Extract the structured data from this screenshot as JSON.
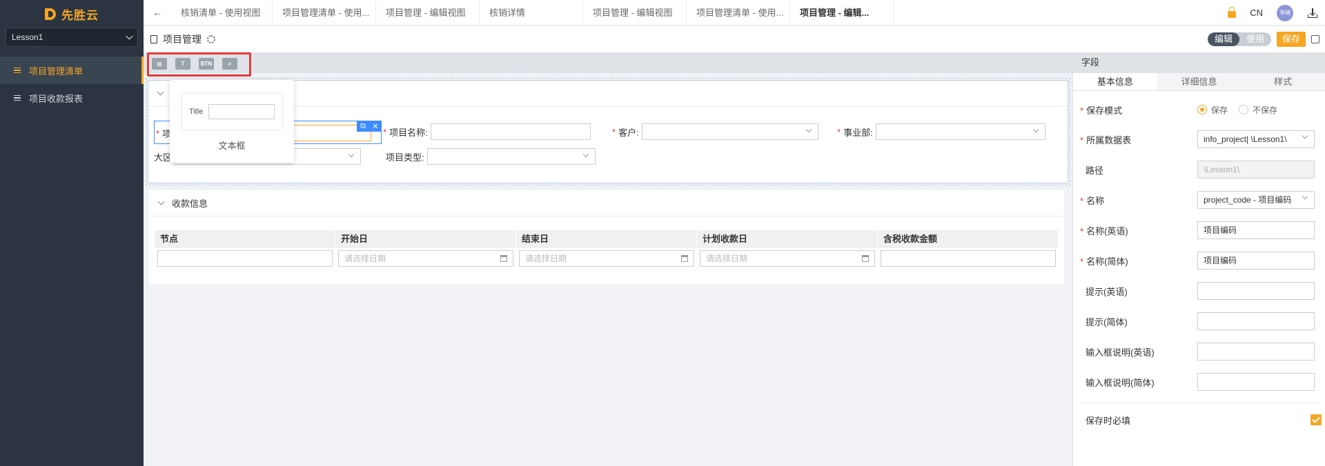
{
  "app": {
    "brand": "先胜云",
    "project_select": "Lesson1"
  },
  "sidebar": {
    "items": [
      {
        "label": "项目管理清单",
        "active": true
      },
      {
        "label": "项目收款报表",
        "active": false
      }
    ]
  },
  "tabs": [
    {
      "label": "核销清单 - 使用视图",
      "active": false
    },
    {
      "label": "项目管理清单 - 使用...",
      "active": false
    },
    {
      "label": "项目管理 - 编辑视图",
      "active": false
    },
    {
      "label": "核销详情",
      "active": false
    },
    {
      "label": "项目管理 - 编辑视图",
      "active": false
    },
    {
      "label": "项目管理清单 - 使用...",
      "active": false
    },
    {
      "label": "项目管理 - 编辑...",
      "active": true
    }
  ],
  "topbar": {
    "lang": "CN",
    "avatar_text": "韦晴"
  },
  "page": {
    "title": "项目管理",
    "mode_edit": "编辑",
    "mode_use": "使用",
    "save": "保存"
  },
  "toolbar": {
    "tools": [
      "layout-icon",
      "text-icon",
      "BTN",
      "search-box-icon"
    ],
    "btn_label": "BTN"
  },
  "popover": {
    "title": "Title",
    "label": "文本框"
  },
  "form": {
    "project_code_label": "项",
    "project_name_label": "项目名称:",
    "customer_label": "客户:",
    "division_label": "事业部:",
    "region_label": "大区",
    "project_type_label": "项目类型:"
  },
  "payments": {
    "title": "收款信息",
    "columns": [
      "节点",
      "开始日",
      "结束日",
      "计划收款日",
      "含税收款金额"
    ],
    "date_placeholder": "请选择日期"
  },
  "panel": {
    "title": "字段",
    "tabs": [
      "基本信息",
      "详细信息",
      "样式"
    ],
    "save_mode_label": "保存模式",
    "save_mode_on": "保存",
    "save_mode_off": "不保存",
    "table_label": "所属数据表",
    "table_value": "info_project| \\Lesson1\\",
    "path_label": "路径",
    "path_value": "\\Lesson1\\",
    "name_label": "名称",
    "name_value": "project_code - 项目编码",
    "name_en_label": "名称(英语)",
    "name_en_value": "项目编码",
    "name_zh_label": "名称(简体)",
    "name_zh_value": "项目编码",
    "hint_en_label": "提示(英语)",
    "hint_zh_label": "提示(简体)",
    "desc_en_label": "输入框说明(英语)",
    "desc_zh_label": "输入框说明(简体)",
    "required_label": "保存时必填"
  },
  "colors": {
    "accent": "#f5a623",
    "sidebar_bg": "#2b3440",
    "selection": "#3d8bff",
    "highlight_box": "#e53935"
  }
}
